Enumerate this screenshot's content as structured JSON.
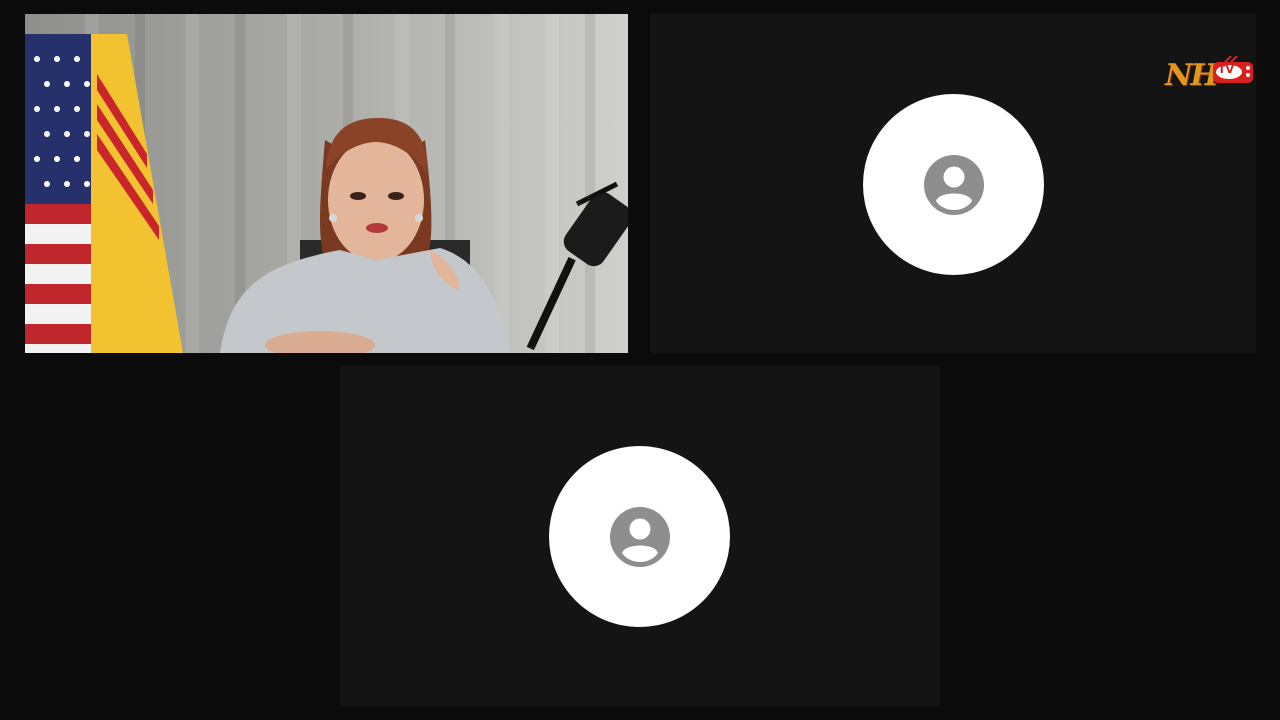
{
  "meeting": {
    "tiles": [
      {
        "kind": "camera",
        "label": ""
      },
      {
        "kind": "avatar",
        "icon": "person-icon"
      },
      {
        "kind": "avatar",
        "icon": "person-icon"
      }
    ]
  },
  "logo": {
    "text": "NH",
    "tv_text": "TV"
  },
  "colors": {
    "background": "#0b0b0b",
    "tile": "#141414",
    "avatar_circle": "#ffffff",
    "avatar_icon": "#8e8e8e",
    "logo_gold": "#e0961f",
    "logo_red": "#d91f1f"
  }
}
